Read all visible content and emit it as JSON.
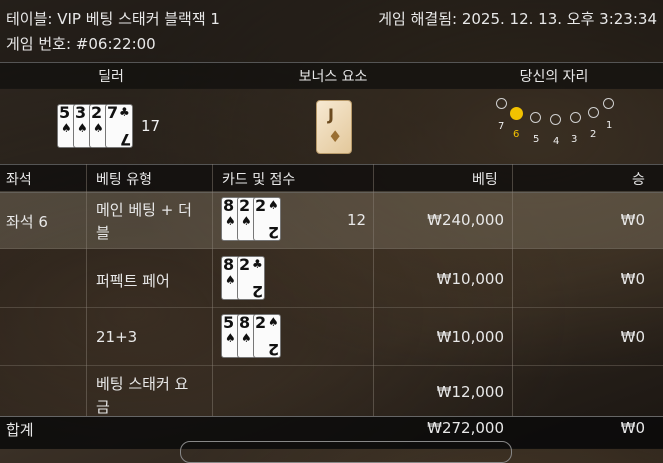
{
  "header": {
    "table_title": "테이블: VIP 베팅 스태커 블랙잭 1",
    "game_round": "게임 번호: #06:22:00",
    "resolved_time": "게임 해결됨: 2025. 12. 13. 오후 3:23:34"
  },
  "sections": {
    "dealer": "딜러",
    "bonus": "보너스 요소",
    "your_seat": "당신의 자리"
  },
  "dealer": {
    "cards": [
      {
        "rank": "5",
        "suit": "♠"
      },
      {
        "rank": "3",
        "suit": "♠"
      },
      {
        "rank": "2",
        "suit": "♠"
      },
      {
        "rank": "7",
        "suit": "♣"
      }
    ],
    "score": "17"
  },
  "bonus_card": {
    "rank": "J",
    "suit": "♦"
  },
  "seats": {
    "labels": [
      "7",
      "6",
      "5",
      "4",
      "3",
      "2",
      "1"
    ],
    "active": "6"
  },
  "table": {
    "columns": [
      "좌석",
      "베팅 유형",
      "카드 및 점수",
      "베팅",
      "승"
    ],
    "seat_label": "좌석 6",
    "rows": [
      {
        "bet_type_line1": "메인 베팅 + 더",
        "bet_type_line2": "블",
        "cards": [
          {
            "rank": "8",
            "suit": "♠"
          },
          {
            "rank": "2",
            "suit": "♠"
          },
          {
            "rank": "2",
            "suit": "♠"
          }
        ],
        "score": "12",
        "bet": "₩240,000",
        "win": "₩0"
      },
      {
        "bet_type_line1": "퍼펙트 페어",
        "bet_type_line2": "",
        "cards": [
          {
            "rank": "8",
            "suit": "♠"
          },
          {
            "rank": "2",
            "suit": "♣"
          }
        ],
        "score": "",
        "bet": "₩10,000",
        "win": "₩0"
      },
      {
        "bet_type_line1": "21+3",
        "bet_type_line2": "",
        "cards": [
          {
            "rank": "5",
            "suit": "♠"
          },
          {
            "rank": "8",
            "suit": "♠"
          },
          {
            "rank": "2",
            "suit": "♠"
          }
        ],
        "score": "",
        "bet": "₩10,000",
        "win": "₩0"
      },
      {
        "bet_type_line1": "베팅 스태커 요",
        "bet_type_line2": "금",
        "cards": [],
        "score": "",
        "bet": "₩12,000",
        "win": ""
      }
    ],
    "total_label": "합계",
    "total_bet": "₩272,000",
    "total_win": "₩0"
  }
}
